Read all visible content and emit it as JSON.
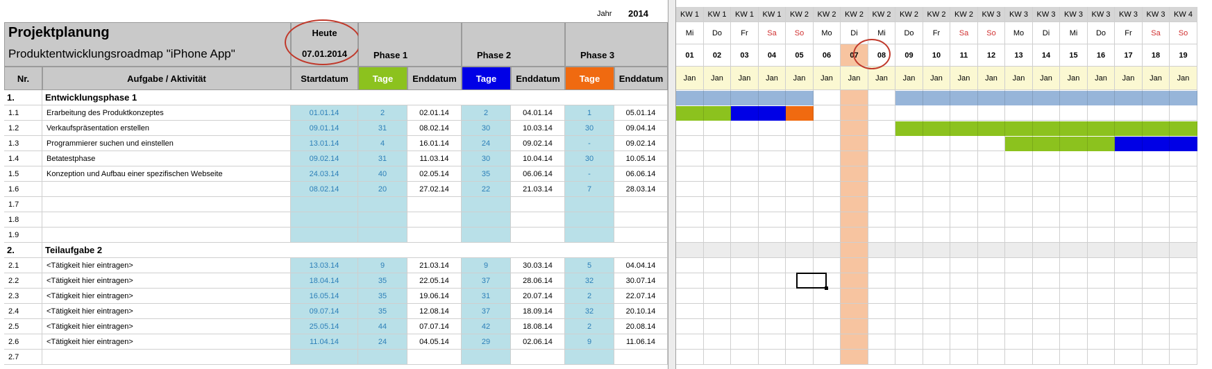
{
  "sheet": {
    "year_label": "Jahr",
    "year_value": "2014",
    "title": "Projektplanung",
    "subtitle": "Produktentwicklungsroadmap \"iPhone App\"",
    "today_label": "Heute",
    "today_value": "07.01.2014",
    "phase1_label": "Phase 1",
    "phase2_label": "Phase 2",
    "phase3_label": "Phase 3",
    "col_nr": "Nr.",
    "col_task": "Aufgabe / Aktivität",
    "col_start": "Startdatum",
    "col_tage": "Tage",
    "col_end": "Enddatum",
    "colors": {
      "green": "#8cc21e",
      "blue": "#0000e6",
      "orange": "#f06a10",
      "today": "#f7c4a0",
      "bar_light": "#97b5d9",
      "input_blue": "#b9e0e8"
    }
  },
  "gantt_days": [
    {
      "kw": "KW 1",
      "wd": "Mi",
      "day": "01",
      "mon": "Jan",
      "weekend": false
    },
    {
      "kw": "KW 1",
      "wd": "Do",
      "day": "02",
      "mon": "Jan",
      "weekend": false
    },
    {
      "kw": "KW 1",
      "wd": "Fr",
      "day": "03",
      "mon": "Jan",
      "weekend": false
    },
    {
      "kw": "KW 1",
      "wd": "Sa",
      "day": "04",
      "mon": "Jan",
      "weekend": true
    },
    {
      "kw": "KW 2",
      "wd": "So",
      "day": "05",
      "mon": "Jan",
      "weekend": true
    },
    {
      "kw": "KW 2",
      "wd": "Mo",
      "day": "06",
      "mon": "Jan",
      "weekend": false
    },
    {
      "kw": "KW 2",
      "wd": "Di",
      "day": "07",
      "mon": "Jan",
      "weekend": false
    },
    {
      "kw": "KW 2",
      "wd": "Mi",
      "day": "08",
      "mon": "Jan",
      "weekend": false
    },
    {
      "kw": "KW 2",
      "wd": "Do",
      "day": "09",
      "mon": "Jan",
      "weekend": false
    },
    {
      "kw": "KW 2",
      "wd": "Fr",
      "day": "10",
      "mon": "Jan",
      "weekend": false
    },
    {
      "kw": "KW 2",
      "wd": "Sa",
      "day": "11",
      "mon": "Jan",
      "weekend": true
    },
    {
      "kw": "KW 3",
      "wd": "So",
      "day": "12",
      "mon": "Jan",
      "weekend": true
    },
    {
      "kw": "KW 3",
      "wd": "Mo",
      "day": "13",
      "mon": "Jan",
      "weekend": false
    },
    {
      "kw": "KW 3",
      "wd": "Di",
      "day": "14",
      "mon": "Jan",
      "weekend": false
    },
    {
      "kw": "KW 3",
      "wd": "Mi",
      "day": "15",
      "mon": "Jan",
      "weekend": false
    },
    {
      "kw": "KW 3",
      "wd": "Do",
      "day": "16",
      "mon": "Jan",
      "weekend": false
    },
    {
      "kw": "KW 3",
      "wd": "Fr",
      "day": "17",
      "mon": "Jan",
      "weekend": false
    },
    {
      "kw": "KW 3",
      "wd": "Sa",
      "day": "18",
      "mon": "Jan",
      "weekend": true
    },
    {
      "kw": "KW 4",
      "wd": "So",
      "day": "19",
      "mon": "Jan",
      "weekend": true
    }
  ],
  "rows": [
    {
      "type": "section",
      "nr": "1.",
      "task": "Entwicklungsphase 1",
      "bars": [
        {
          "from": 0,
          "to": 5,
          "color": "bar_light"
        },
        {
          "from": 8,
          "to": 19,
          "color": "bar_light"
        }
      ]
    },
    {
      "type": "task",
      "nr": "1.1",
      "task": "Erarbeitung des Produktkonzeptes",
      "start": "01.01.14",
      "t1": "2",
      "e1": "02.01.14",
      "t2": "2",
      "e2": "04.01.14",
      "t3": "1",
      "e3": "05.01.14",
      "bars": [
        {
          "from": 0,
          "to": 2,
          "color": "green"
        },
        {
          "from": 2,
          "to": 4,
          "color": "blue"
        },
        {
          "from": 4,
          "to": 5,
          "color": "orange"
        }
      ]
    },
    {
      "type": "task",
      "nr": "1.2",
      "task": "Verkaufspräsentation erstellen",
      "start": "09.01.14",
      "t1": "31",
      "e1": "08.02.14",
      "t2": "30",
      "e2": "10.03.14",
      "t3": "30",
      "e3": "09.04.14",
      "bars": [
        {
          "from": 8,
          "to": 19,
          "color": "green"
        }
      ]
    },
    {
      "type": "task",
      "nr": "1.3",
      "task": "Programmierer suchen und einstellen",
      "start": "13.01.14",
      "t1": "4",
      "e1": "16.01.14",
      "t2": "24",
      "e2": "09.02.14",
      "t3": "-",
      "e3": "09.02.14",
      "bars": [
        {
          "from": 12,
          "to": 16,
          "color": "green"
        },
        {
          "from": 16,
          "to": 19,
          "color": "blue"
        }
      ]
    },
    {
      "type": "task",
      "nr": "1.4",
      "task": "Betatestphase",
      "start": "09.02.14",
      "t1": "31",
      "e1": "11.03.14",
      "t2": "30",
      "e2": "10.04.14",
      "t3": "30",
      "e3": "10.05.14",
      "bars": []
    },
    {
      "type": "task",
      "nr": "1.5",
      "task": "Konzeption und Aufbau einer spezifischen Webseite",
      "start": "24.03.14",
      "t1": "40",
      "e1": "02.05.14",
      "t2": "35",
      "e2": "06.06.14",
      "t3": "-",
      "e3": "06.06.14",
      "bars": []
    },
    {
      "type": "task",
      "nr": "1.6",
      "task": "",
      "start": "08.02.14",
      "t1": "20",
      "e1": "27.02.14",
      "t2": "22",
      "e2": "21.03.14",
      "t3": "7",
      "e3": "28.03.14",
      "bars": []
    },
    {
      "type": "task",
      "nr": "1.7",
      "task": "",
      "start": "",
      "t1": "",
      "e1": "",
      "t2": "",
      "e2": "",
      "t3": "",
      "e3": "",
      "bars": []
    },
    {
      "type": "task",
      "nr": "1.8",
      "task": "",
      "start": "",
      "t1": "",
      "e1": "",
      "t2": "",
      "e2": "",
      "t3": "",
      "e3": "",
      "bars": []
    },
    {
      "type": "task",
      "nr": "1.9",
      "task": "",
      "start": "",
      "t1": "",
      "e1": "",
      "t2": "",
      "e2": "",
      "t3": "",
      "e3": "",
      "bars": []
    },
    {
      "type": "section",
      "nr": "2.",
      "task": "Teilaufgabe 2",
      "bars": []
    },
    {
      "type": "task",
      "nr": "2.1",
      "task": "<Tätigkeit hier eintragen>",
      "start": "13.03.14",
      "t1": "9",
      "e1": "21.03.14",
      "t2": "9",
      "e2": "30.03.14",
      "t3": "5",
      "e3": "04.04.14",
      "bars": []
    },
    {
      "type": "task",
      "nr": "2.2",
      "task": "<Tätigkeit hier eintragen>",
      "start": "18.04.14",
      "t1": "35",
      "e1": "22.05.14",
      "t2": "37",
      "e2": "28.06.14",
      "t3": "32",
      "e3": "30.07.14",
      "bars": []
    },
    {
      "type": "task",
      "nr": "2.3",
      "task": "<Tätigkeit hier eintragen>",
      "start": "16.05.14",
      "t1": "35",
      "e1": "19.06.14",
      "t2": "31",
      "e2": "20.07.14",
      "t3": "2",
      "e3": "22.07.14",
      "bars": []
    },
    {
      "type": "task",
      "nr": "2.4",
      "task": "<Tätigkeit hier eintragen>",
      "start": "09.07.14",
      "t1": "35",
      "e1": "12.08.14",
      "t2": "37",
      "e2": "18.09.14",
      "t3": "32",
      "e3": "20.10.14",
      "bars": []
    },
    {
      "type": "task",
      "nr": "2.5",
      "task": "<Tätigkeit hier eintragen>",
      "start": "25.05.14",
      "t1": "44",
      "e1": "07.07.14",
      "t2": "42",
      "e2": "18.08.14",
      "t3": "2",
      "e3": "20.08.14",
      "bars": []
    },
    {
      "type": "task",
      "nr": "2.6",
      "task": "<Tätigkeit hier eintragen>",
      "start": "11.04.14",
      "t1": "24",
      "e1": "04.05.14",
      "t2": "29",
      "e2": "02.06.14",
      "t3": "9",
      "e3": "11.06.14",
      "bars": []
    },
    {
      "type": "task",
      "nr": "2.7",
      "task": "",
      "start": "",
      "t1": "",
      "e1": "",
      "t2": "",
      "e2": "",
      "t3": "",
      "e3": "",
      "bars": []
    }
  ]
}
